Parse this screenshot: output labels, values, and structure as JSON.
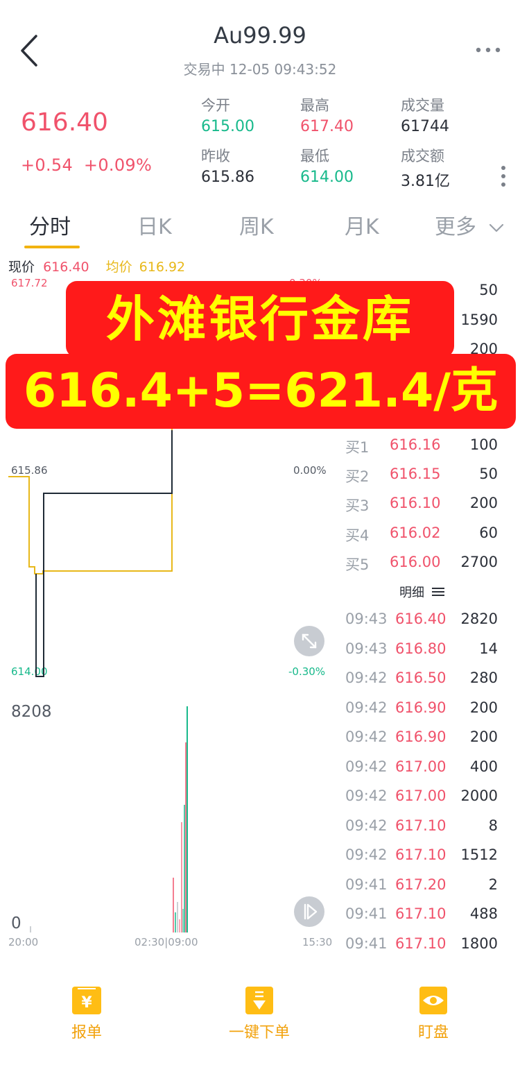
{
  "header": {
    "title": "Au99.99",
    "subtitle": "交易中 12-05 09:43:52"
  },
  "quote": {
    "last": "616.40",
    "change": "+0.54",
    "change_pct": "+0.09%",
    "stats": [
      {
        "label": "今开",
        "value": "615.00",
        "color": "green"
      },
      {
        "label": "最高",
        "value": "617.40",
        "color": "red"
      },
      {
        "label": "成交量",
        "value": "61744",
        "color": "dark"
      },
      {
        "label": "昨收",
        "value": "615.86",
        "color": "dark"
      },
      {
        "label": "最低",
        "value": "614.00",
        "color": "green"
      },
      {
        "label": "成交额",
        "value": "3.81亿",
        "color": "dark"
      }
    ]
  },
  "tabs": [
    {
      "label": "分时",
      "active": true
    },
    {
      "label": "日K"
    },
    {
      "label": "周K"
    },
    {
      "label": "月K"
    },
    {
      "label": "更多"
    }
  ],
  "legend": {
    "now_label": "现价",
    "now_value": "616.40",
    "avg_label": "均价",
    "avg_value": "616.92"
  },
  "chart": {
    "y_top": "617.72",
    "pct_top": "0.30%",
    "y_mid": "615.86",
    "pct_mid": "0.00%",
    "y_bottom": "614.00",
    "pct_bottom": "-0.30%",
    "vol_max": "8208",
    "vol_zero": "0",
    "t_start": "20:00",
    "t_mid": "02:30|09:00",
    "t_end": "15:30"
  },
  "banner": {
    "line1": "外滩银行金库",
    "line2": "616.4+5=621.4/克"
  },
  "order_book": {
    "asks_visible": [
      "50",
      "1590",
      "200"
    ],
    "bids": [
      {
        "label": "买1",
        "price": "616.16",
        "vol": "100"
      },
      {
        "label": "买2",
        "price": "616.15",
        "vol": "50"
      },
      {
        "label": "买3",
        "price": "616.10",
        "vol": "200"
      },
      {
        "label": "买4",
        "price": "616.02",
        "vol": "60"
      },
      {
        "label": "买5",
        "price": "616.00",
        "vol": "2700"
      }
    ],
    "detail_label": "明细"
  },
  "trades": [
    {
      "time": "09:43",
      "price": "616.40",
      "vol": "2820"
    },
    {
      "time": "09:43",
      "price": "616.80",
      "vol": "14"
    },
    {
      "time": "09:42",
      "price": "616.50",
      "vol": "280"
    },
    {
      "time": "09:42",
      "price": "616.90",
      "vol": "200"
    },
    {
      "time": "09:42",
      "price": "616.90",
      "vol": "200"
    },
    {
      "time": "09:42",
      "price": "617.00",
      "vol": "400"
    },
    {
      "time": "09:42",
      "price": "617.00",
      "vol": "2000"
    },
    {
      "time": "09:42",
      "price": "617.10",
      "vol": "8"
    },
    {
      "time": "09:42",
      "price": "617.10",
      "vol": "1512"
    },
    {
      "time": "09:41",
      "price": "617.20",
      "vol": "2"
    },
    {
      "time": "09:41",
      "price": "617.10",
      "vol": "488"
    },
    {
      "time": "09:41",
      "price": "617.10",
      "vol": "1800"
    }
  ],
  "bottom_bar": [
    {
      "label": "报单",
      "icon": "yen-icon"
    },
    {
      "label": "一键下单",
      "icon": "download-order-icon"
    },
    {
      "label": "盯盘",
      "icon": "eye-icon"
    }
  ],
  "colors": {
    "up": "#f0526b",
    "down": "#17b98b",
    "avg_line": "#e8b81a",
    "accent": "#f2b310",
    "banner_bg": "#ff1a1a",
    "banner_text": "#ffff00"
  }
}
